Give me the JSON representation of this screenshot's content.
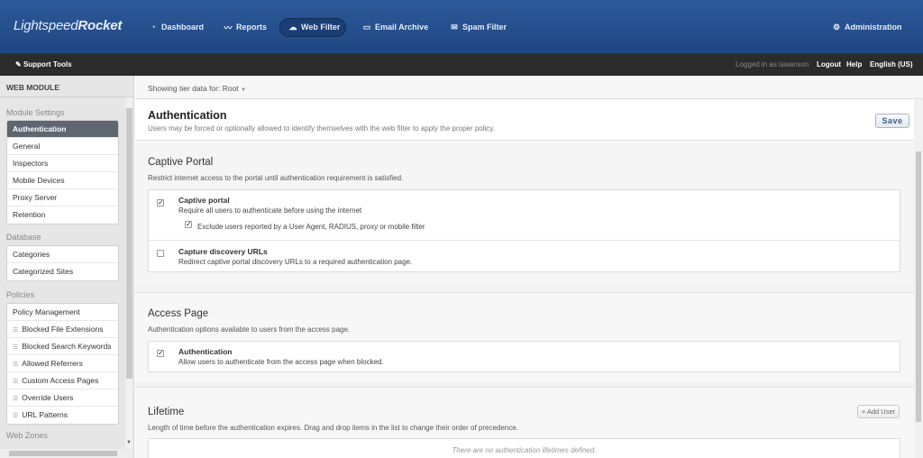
{
  "app": {
    "logo_light": "Lightspeed",
    "logo_bold": "Rocket"
  },
  "nav": [
    {
      "label": "Dashboard",
      "icon": "dashboard-icon"
    },
    {
      "label": "Reports",
      "icon": "reports-icon"
    },
    {
      "label": "Web Filter",
      "icon": "cloud-icon",
      "active": true
    },
    {
      "label": "Email Archive",
      "icon": "archive-icon"
    },
    {
      "label": "Spam Filter",
      "icon": "mail-icon"
    },
    {
      "label": "Administration",
      "icon": "gear-icon"
    }
  ],
  "subbar": {
    "support": "Support Tools",
    "logged_in": "Logged in as iswanson",
    "logout": "Logout",
    "help": "Help",
    "language": "English (US)"
  },
  "sidebar": {
    "header": "WEB MODULE",
    "module_settings": {
      "title": "Module Settings",
      "items": [
        "Authentication",
        "General",
        "Inspectors",
        "Mobile Devices",
        "Proxy Server",
        "Retention"
      ]
    },
    "database": {
      "title": "Database",
      "items": [
        "Categories",
        "Categorized Sites"
      ]
    },
    "policies": {
      "title": "Policies",
      "items": [
        "Policy Management",
        "Blocked File Extensions",
        "Blocked Search Keywords",
        "Allowed Referrers",
        "Custom Access Pages",
        "Override Users",
        "URL Patterns"
      ]
    },
    "web_zones": {
      "title": "Web Zones"
    }
  },
  "main": {
    "tier_label": "Showing tier data for:",
    "tier_value": "Root",
    "title": "Authentication",
    "subtitle": "Users may be forced or optionally allowed to identify themselves with the web filter to apply the proper policy.",
    "save": "Save",
    "captive": {
      "title": "Captive Portal",
      "desc": "Restrict internet access to the portal until authentication requirement is satisfied.",
      "portal_title": "Captive portal",
      "portal_desc": "Require all users to authenticate before using the internet",
      "exclude_label": "Exclude users reported by a User Agent, RADIUS, proxy or mobile filter",
      "discovery_title": "Capture discovery URLs",
      "discovery_desc": "Redirect captive portal discovery URLs to a required authentication page.",
      "portal_checked": true,
      "exclude_checked": true,
      "discovery_checked": false
    },
    "access": {
      "title": "Access Page",
      "desc": "Authentication options available to users from the access page.",
      "auth_title": "Authentication",
      "auth_desc": "Allow users to authenticate from the access page when blocked.",
      "auth_checked": true
    },
    "lifetime": {
      "title": "Lifetime",
      "desc": "Length of time before the authentication expires. Drag and drop items in the list to change their order of precedence.",
      "add_user": "+ Add User",
      "empty": "There are no authentication lifetimes defined."
    }
  }
}
